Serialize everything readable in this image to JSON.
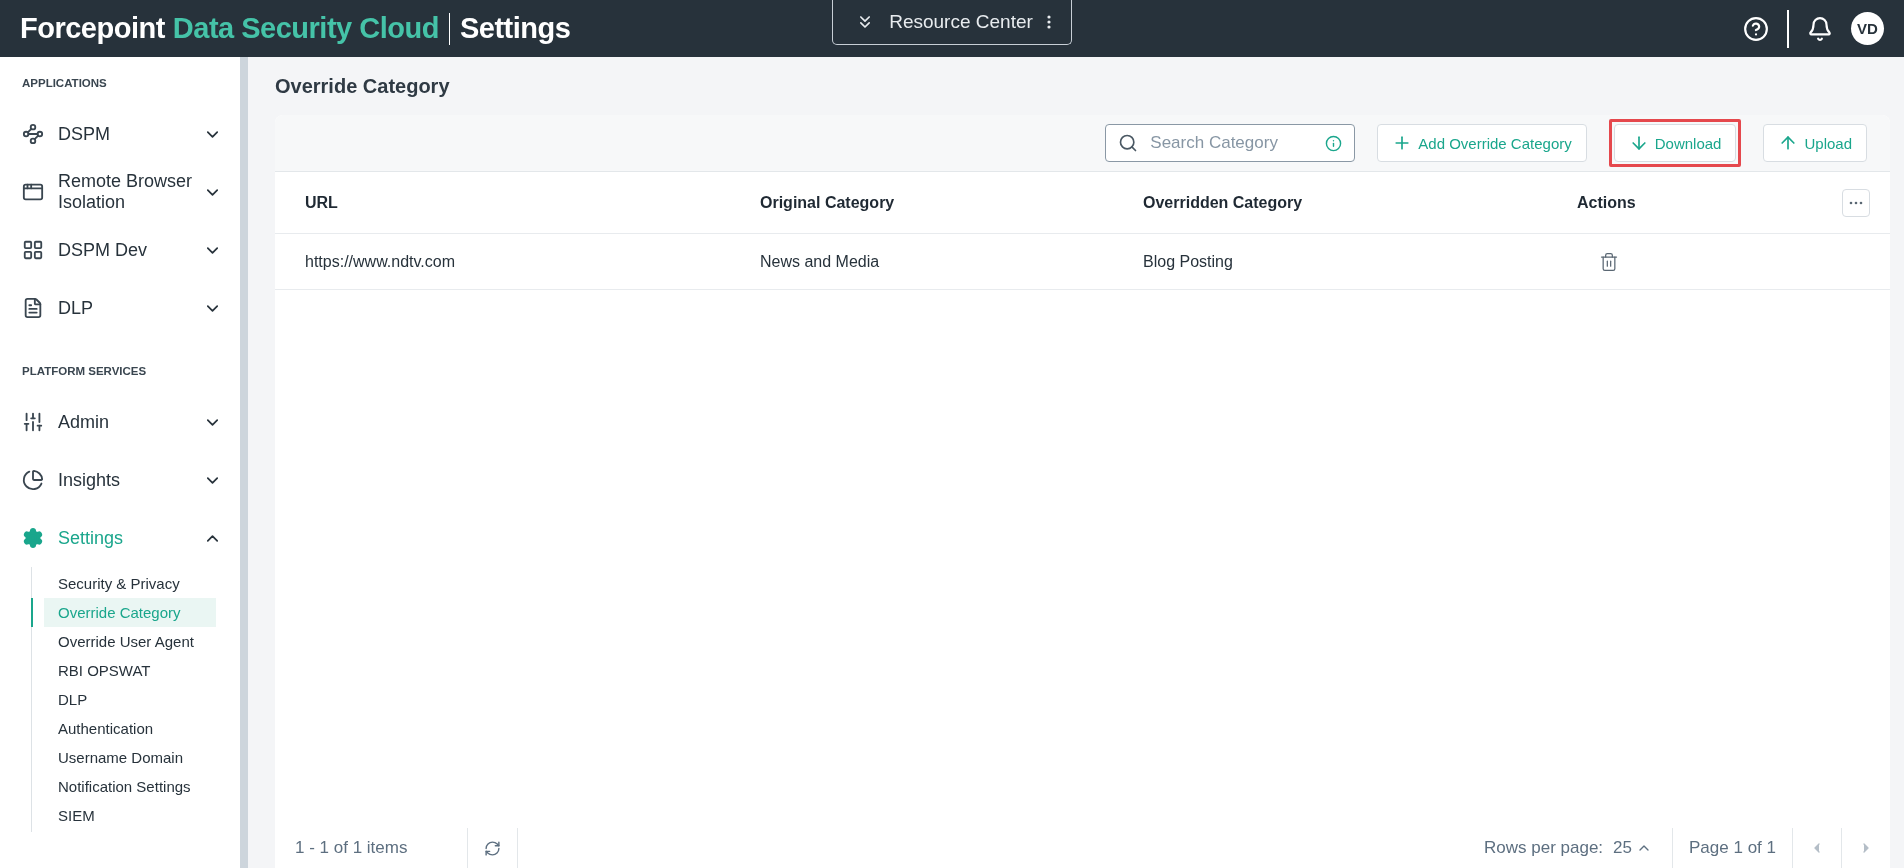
{
  "header": {
    "brand": "Forcepoint",
    "product": "Data Security Cloud",
    "section": "Settings",
    "resource_center": "Resource Center",
    "avatar": "VD"
  },
  "sidebar": {
    "groups": [
      {
        "heading": "APPLICATIONS",
        "items": [
          {
            "label": "DSPM",
            "expanded": false,
            "selected": false
          },
          {
            "label": "Remote Browser Isolation",
            "expanded": false,
            "selected": false
          },
          {
            "label": "DSPM Dev",
            "expanded": false,
            "selected": false
          },
          {
            "label": "DLP",
            "expanded": false,
            "selected": false
          }
        ]
      },
      {
        "heading": "PLATFORM SERVICES",
        "items": [
          {
            "label": "Admin",
            "expanded": false,
            "selected": false
          },
          {
            "label": "Insights",
            "expanded": false,
            "selected": false
          },
          {
            "label": "Settings",
            "expanded": true,
            "selected": true,
            "children": [
              {
                "label": "Security & Privacy",
                "selected": false
              },
              {
                "label": "Override Category",
                "selected": true
              },
              {
                "label": "Override User Agent",
                "selected": false
              },
              {
                "label": "RBI OPSWAT",
                "selected": false
              },
              {
                "label": "DLP",
                "selected": false
              },
              {
                "label": "Authentication",
                "selected": false
              },
              {
                "label": "Username Domain",
                "selected": false
              },
              {
                "label": "Notification Settings",
                "selected": false
              },
              {
                "label": "SIEM",
                "selected": false
              }
            ]
          }
        ]
      }
    ]
  },
  "page_title": "Override Category",
  "toolbar": {
    "search": {
      "placeholder": "Search Category"
    },
    "buttons": [
      {
        "label": "Add Override Category",
        "kind": "add",
        "highlighted": false
      },
      {
        "label": "Download",
        "kind": "download",
        "highlighted": true
      },
      {
        "label": "Upload",
        "kind": "upload",
        "highlighted": false
      }
    ]
  },
  "table": {
    "columns": [
      "URL",
      "Original Category",
      "Overridden Category",
      "Actions"
    ],
    "rows": [
      {
        "cells": [
          "https://www.ndtv.com",
          "News and Media",
          "Blog Posting"
        ]
      }
    ]
  },
  "footer": {
    "range": "1 - 1 of 1 items",
    "rows_per_page_label": "Rows per page:",
    "rows_per_page": "25",
    "page": "Page 1 of 1"
  }
}
